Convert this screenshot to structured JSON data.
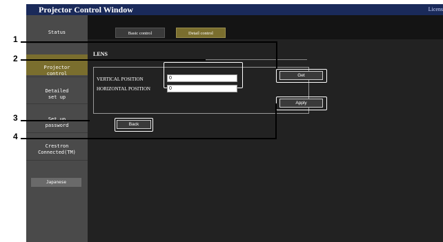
{
  "window": {
    "title": "Projector Control Window",
    "license_link": "Licens"
  },
  "sidebar": {
    "items": [
      {
        "label": "Status",
        "active": false
      },
      {
        "label": "Projector\ncontrol",
        "active": true
      },
      {
        "label": "Detailed\nset up",
        "active": false
      },
      {
        "label": "Set up\npassword",
        "active": false
      },
      {
        "label": "Crestron\nConnected(TM)",
        "active": false
      }
    ],
    "language_button": "Japanese"
  },
  "tabs": [
    {
      "label": "Basic control",
      "active": false
    },
    {
      "label": "Detail control",
      "active": true
    }
  ],
  "main": {
    "heading": "LENS",
    "fields": [
      {
        "label": "VERTICAL POSITION",
        "value": "0"
      },
      {
        "label": "HORIZONTAL POSITION",
        "value": "0"
      }
    ],
    "get_button": "Get",
    "apply_button": "Apply",
    "back_button": "Back"
  },
  "callouts": [
    "1",
    "2",
    "3",
    "4"
  ],
  "colors": {
    "titlebar": "#1a2a5a",
    "active_gold": "#7a6e2e",
    "sidebar": "#4a4a4a",
    "content_bg": "#222222"
  }
}
